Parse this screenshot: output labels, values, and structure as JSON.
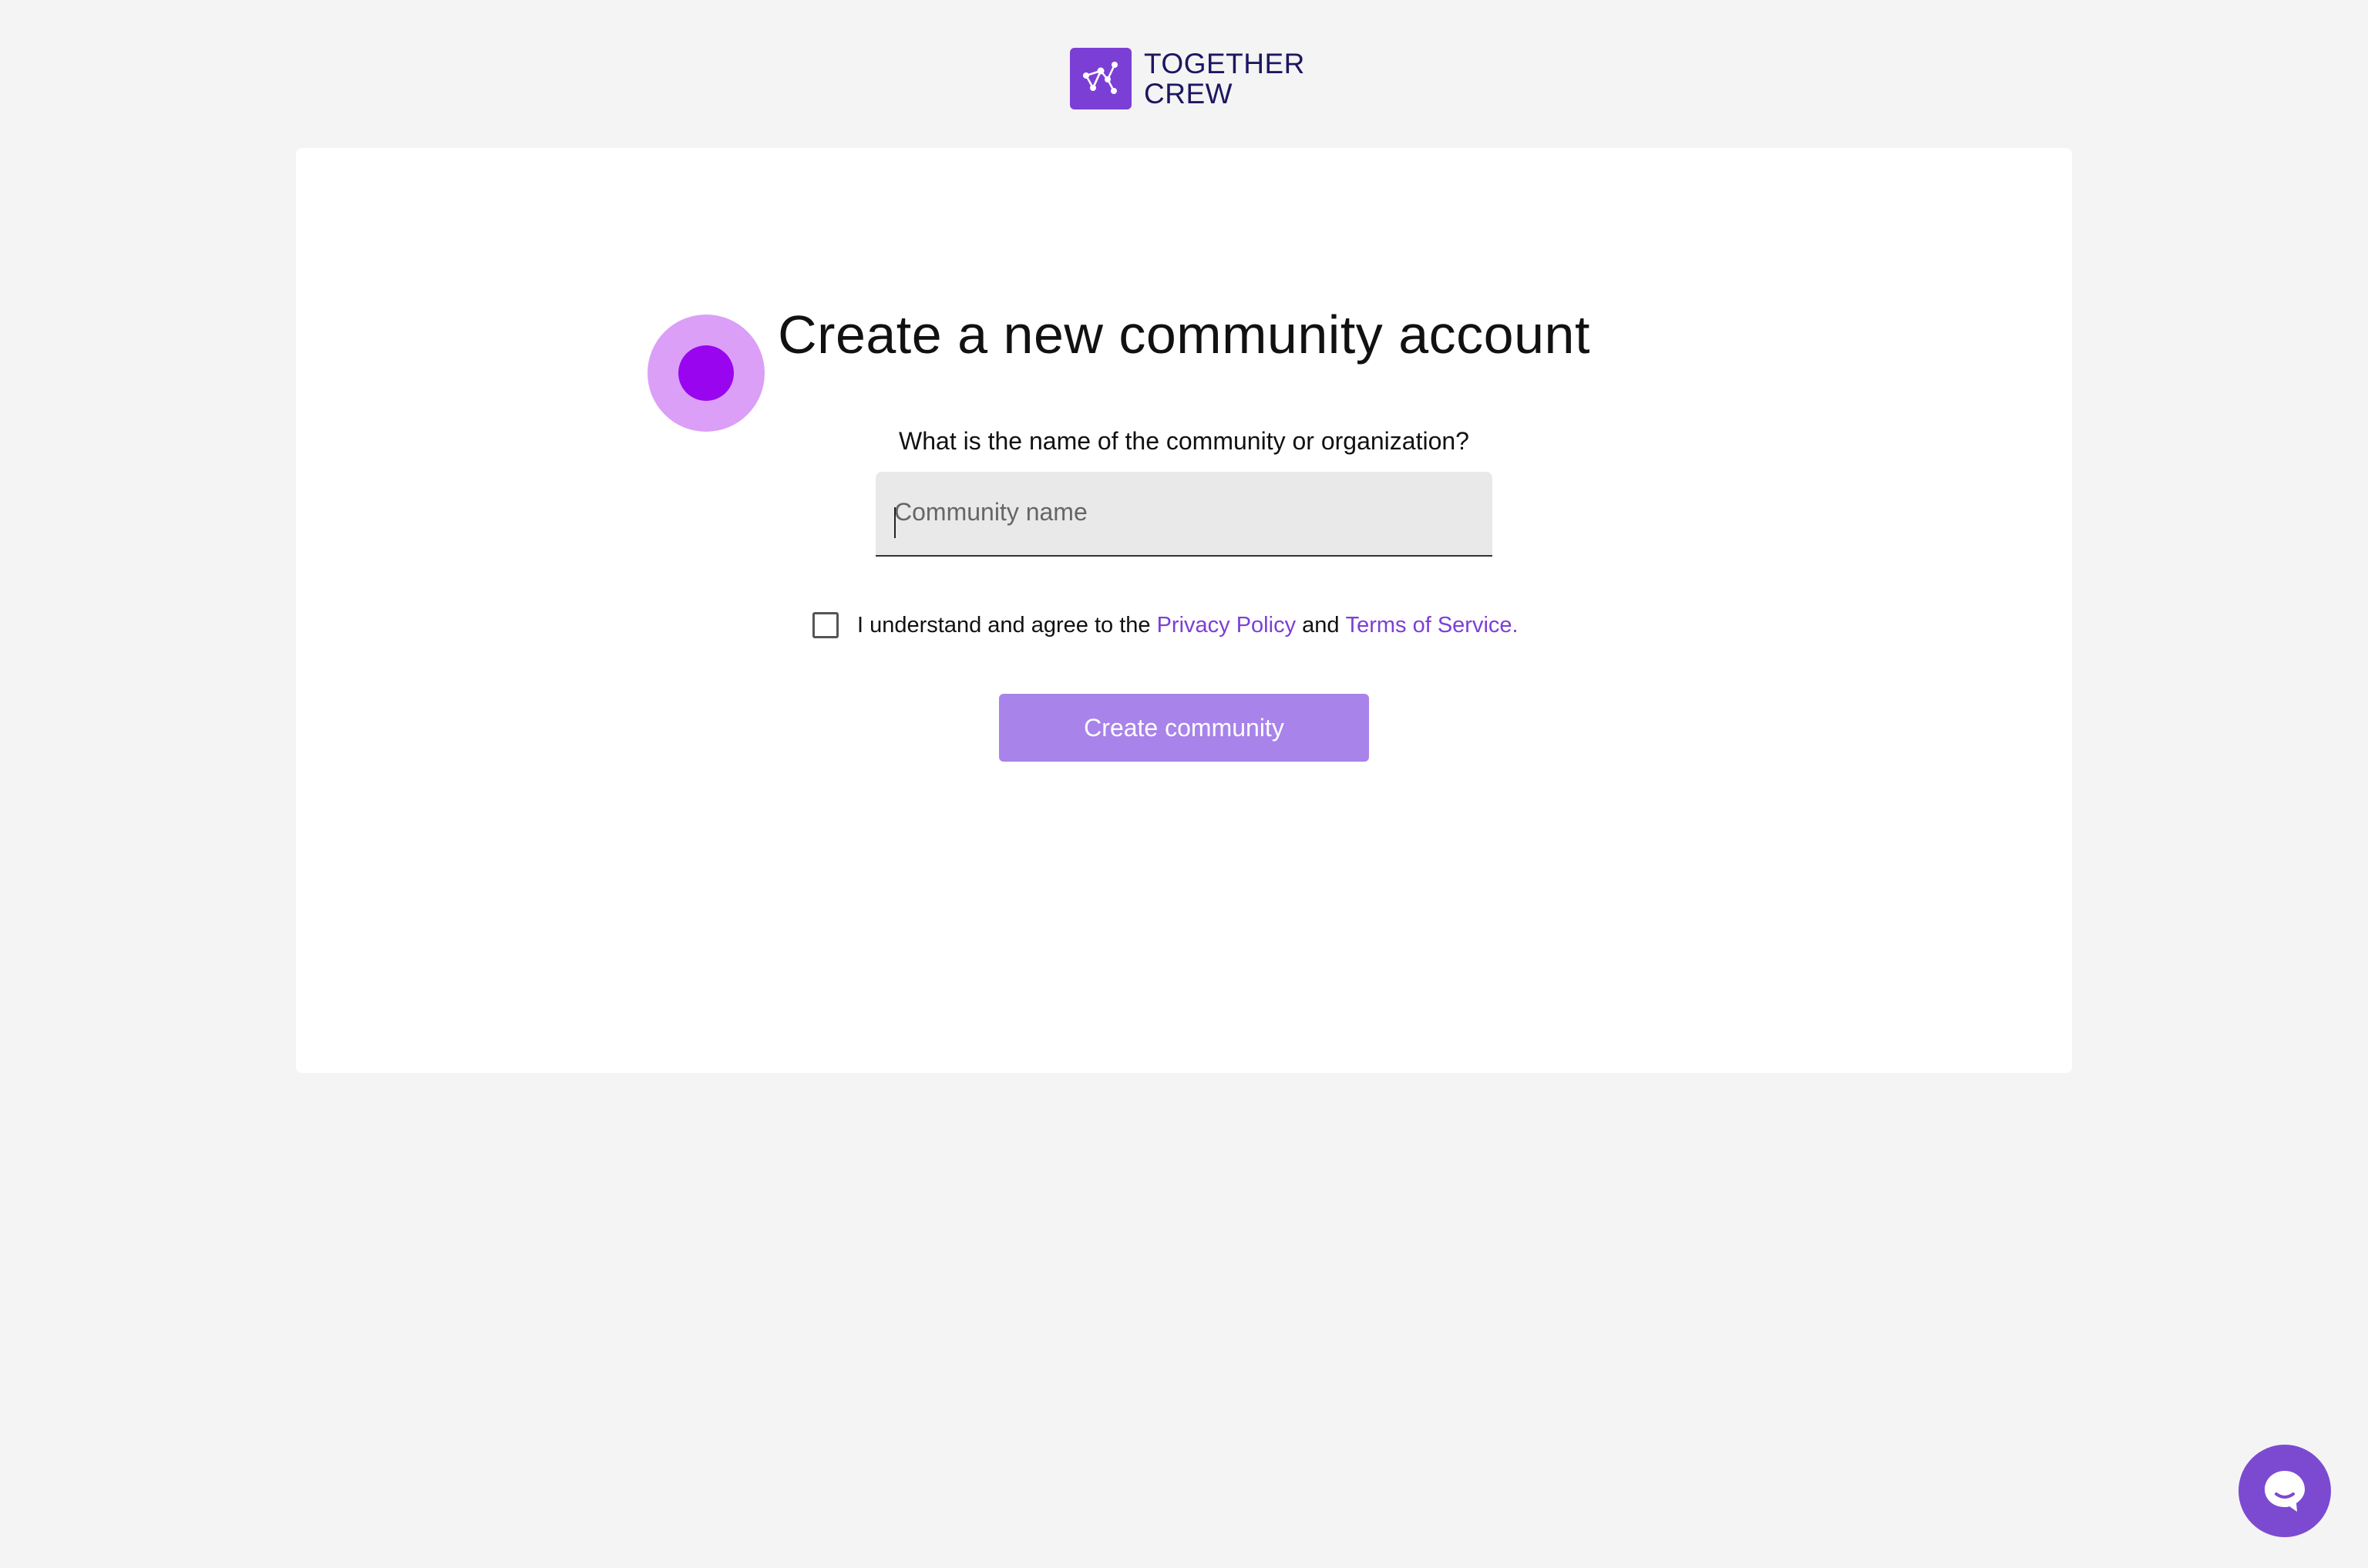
{
  "brand": {
    "logo_line1": "TOGETHER",
    "logo_line2": "CREW",
    "logo_icon": "network-graph-icon",
    "accent_color": "#7c3fd6",
    "button_color": "#a883ea"
  },
  "page": {
    "title": "Create a new community account",
    "question": "What is the name of the community or organization?"
  },
  "community_name": {
    "placeholder": "Community name",
    "value": ""
  },
  "agreement": {
    "checked": false,
    "text_before": "I understand and agree to the",
    "privacy_link": "Privacy Policy",
    "text_between": "and",
    "terms_link": "Terms of Service."
  },
  "actions": {
    "create_label": "Create community"
  },
  "chat": {
    "icon": "chat-bubble-icon"
  }
}
